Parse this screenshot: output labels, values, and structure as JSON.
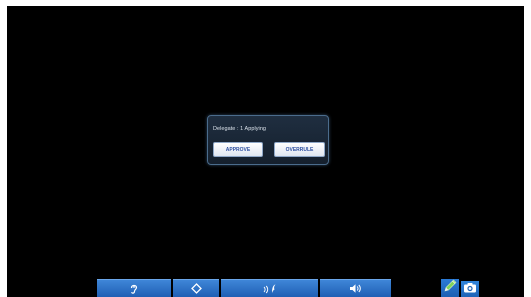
{
  "dialog": {
    "message": "Delegate : 1 Applying",
    "approve_label": "APPROVE",
    "overrule_label": "OVERRULE"
  },
  "toolbar": {
    "buttons": [
      {
        "icon": "hearing-icon"
      },
      {
        "icon": "diamond-icon"
      },
      {
        "icon": "interpretation-icon"
      },
      {
        "icon": "volume-icon"
      }
    ],
    "pen_icon": "pen-icon",
    "camera_icon": "camera-icon"
  },
  "colors": {
    "screen_bg": "#000000",
    "toolbar_blue": "#2a70c8",
    "dialog_bg": "#1a2838",
    "button_text": "#2d4fa0",
    "pen_green": "#7fd35a"
  }
}
